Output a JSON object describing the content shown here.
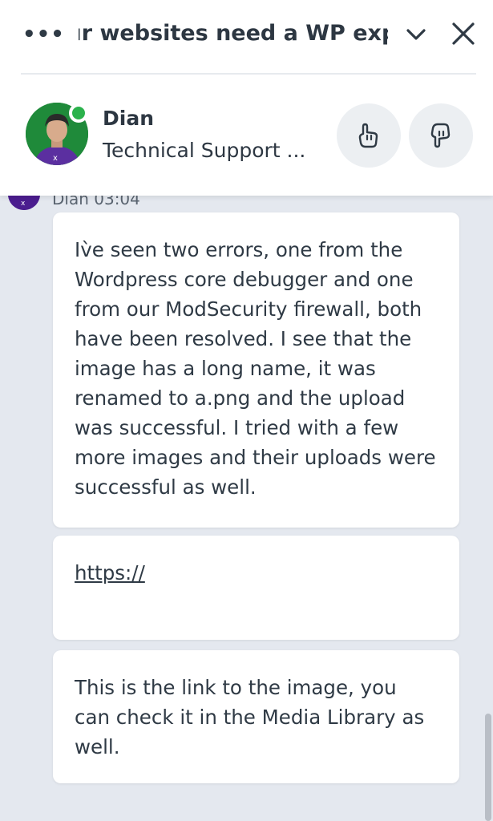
{
  "header": {
    "menu_label": "•••",
    "title": "our websites need a WP expert",
    "icons": {
      "collapse": "chevron-down-icon",
      "close": "close-icon"
    }
  },
  "agent": {
    "name": "Dian",
    "role": "Technical Support ...",
    "status": "online",
    "status_color": "#2bb24c",
    "rate_up_icon": "thumbs-up-icon",
    "rate_down_icon": "thumbs-down-icon"
  },
  "chat": {
    "messages": [
      {
        "meta": "Dian 03:04",
        "text": "Iv̀e seen two errors, one from the Wordpress core debugger and one from our ModSecurity firewall, both have been resolved. I see that the image has a long name, it was renamed to a.png and the upload was successful. I tried with a few more images and their uploads were successful as well."
      },
      {
        "link": "https://"
      },
      {
        "text": "This is the link to the image, you can check it in the Media Library as well."
      }
    ]
  }
}
